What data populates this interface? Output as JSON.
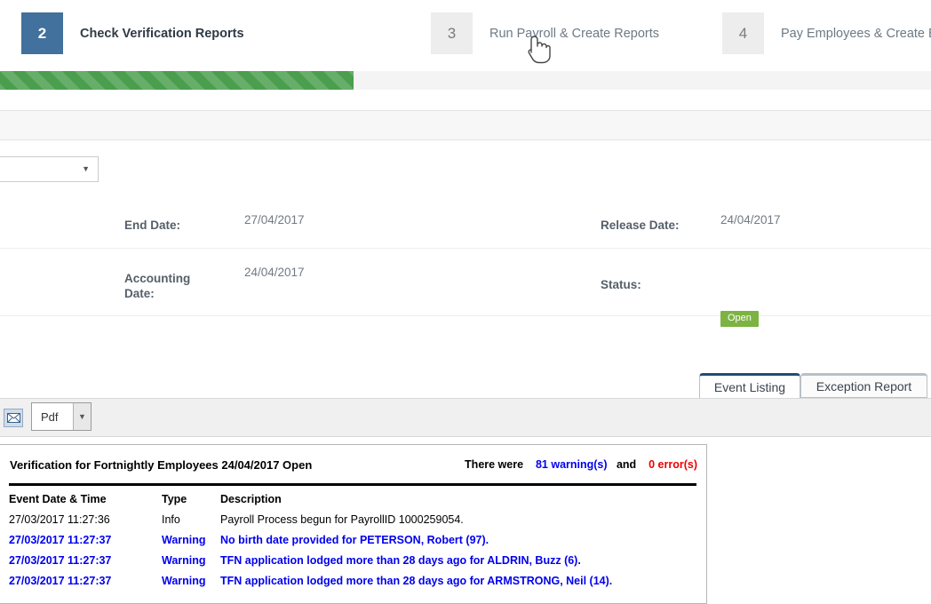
{
  "wizard": {
    "steps": [
      {
        "number": "2",
        "label": "Check Verification Reports",
        "state": "active"
      },
      {
        "number": "3",
        "label": "Run Payroll & Create Reports",
        "state": "inactive"
      },
      {
        "number": "4",
        "label": "Pay Employees & Create Bank",
        "state": "inactive"
      }
    ]
  },
  "progress": {
    "percent": 38,
    "fill_color": "#4a9e4e",
    "track_color": "#f4f4f4"
  },
  "filter_select": {
    "value": "",
    "caret": "chevron-down-icon"
  },
  "details": {
    "end_date_label": "End Date:",
    "end_date_value": "27/04/2017",
    "release_date_label": "Release Date:",
    "release_date_value": "24/04/2017",
    "accounting_date_label": "Accounting Date:",
    "accounting_date_value": "24/04/2017",
    "status_label": "Status:",
    "status_value": "Open",
    "status_color": "#7cb342"
  },
  "tabs": [
    {
      "label": "Event Listing",
      "active": true
    },
    {
      "label": "Exception Report",
      "active": false
    }
  ],
  "toolbar": {
    "mail_icon": "envelope-icon",
    "format_value": "Pdf",
    "format_caret": "chevron-down-icon"
  },
  "report": {
    "title": "Verification for Fortnightly Employees 24/04/2017 Open",
    "counts_prefix": "There were",
    "warnings": "81 warning(s)",
    "counts_join": "and",
    "errors": "0 error(s)",
    "warning_color": "#0000ee",
    "error_color": "#ee0000",
    "columns": [
      "Event Date & Time",
      "Type",
      "Description"
    ],
    "rows": [
      {
        "datetime": "27/03/2017 11:27:36",
        "type": "Info",
        "description": "Payroll Process begun for PayrollID 1000259054.",
        "severity": "info"
      },
      {
        "datetime": "27/03/2017 11:27:37",
        "type": "Warning",
        "description": "No birth date provided for PETERSON, Robert (97).",
        "severity": "warning"
      },
      {
        "datetime": "27/03/2017 11:27:37",
        "type": "Warning",
        "description": "TFN application lodged more than 28 days ago for ALDRIN, Buzz (6).",
        "severity": "warning"
      },
      {
        "datetime": "27/03/2017 11:27:37",
        "type": "Warning",
        "description": "TFN application lodged more than 28 days ago for ARMSTRONG, Neil (14).",
        "severity": "warning"
      }
    ]
  },
  "cursor": {
    "type": "pointing-hand-cursor"
  }
}
